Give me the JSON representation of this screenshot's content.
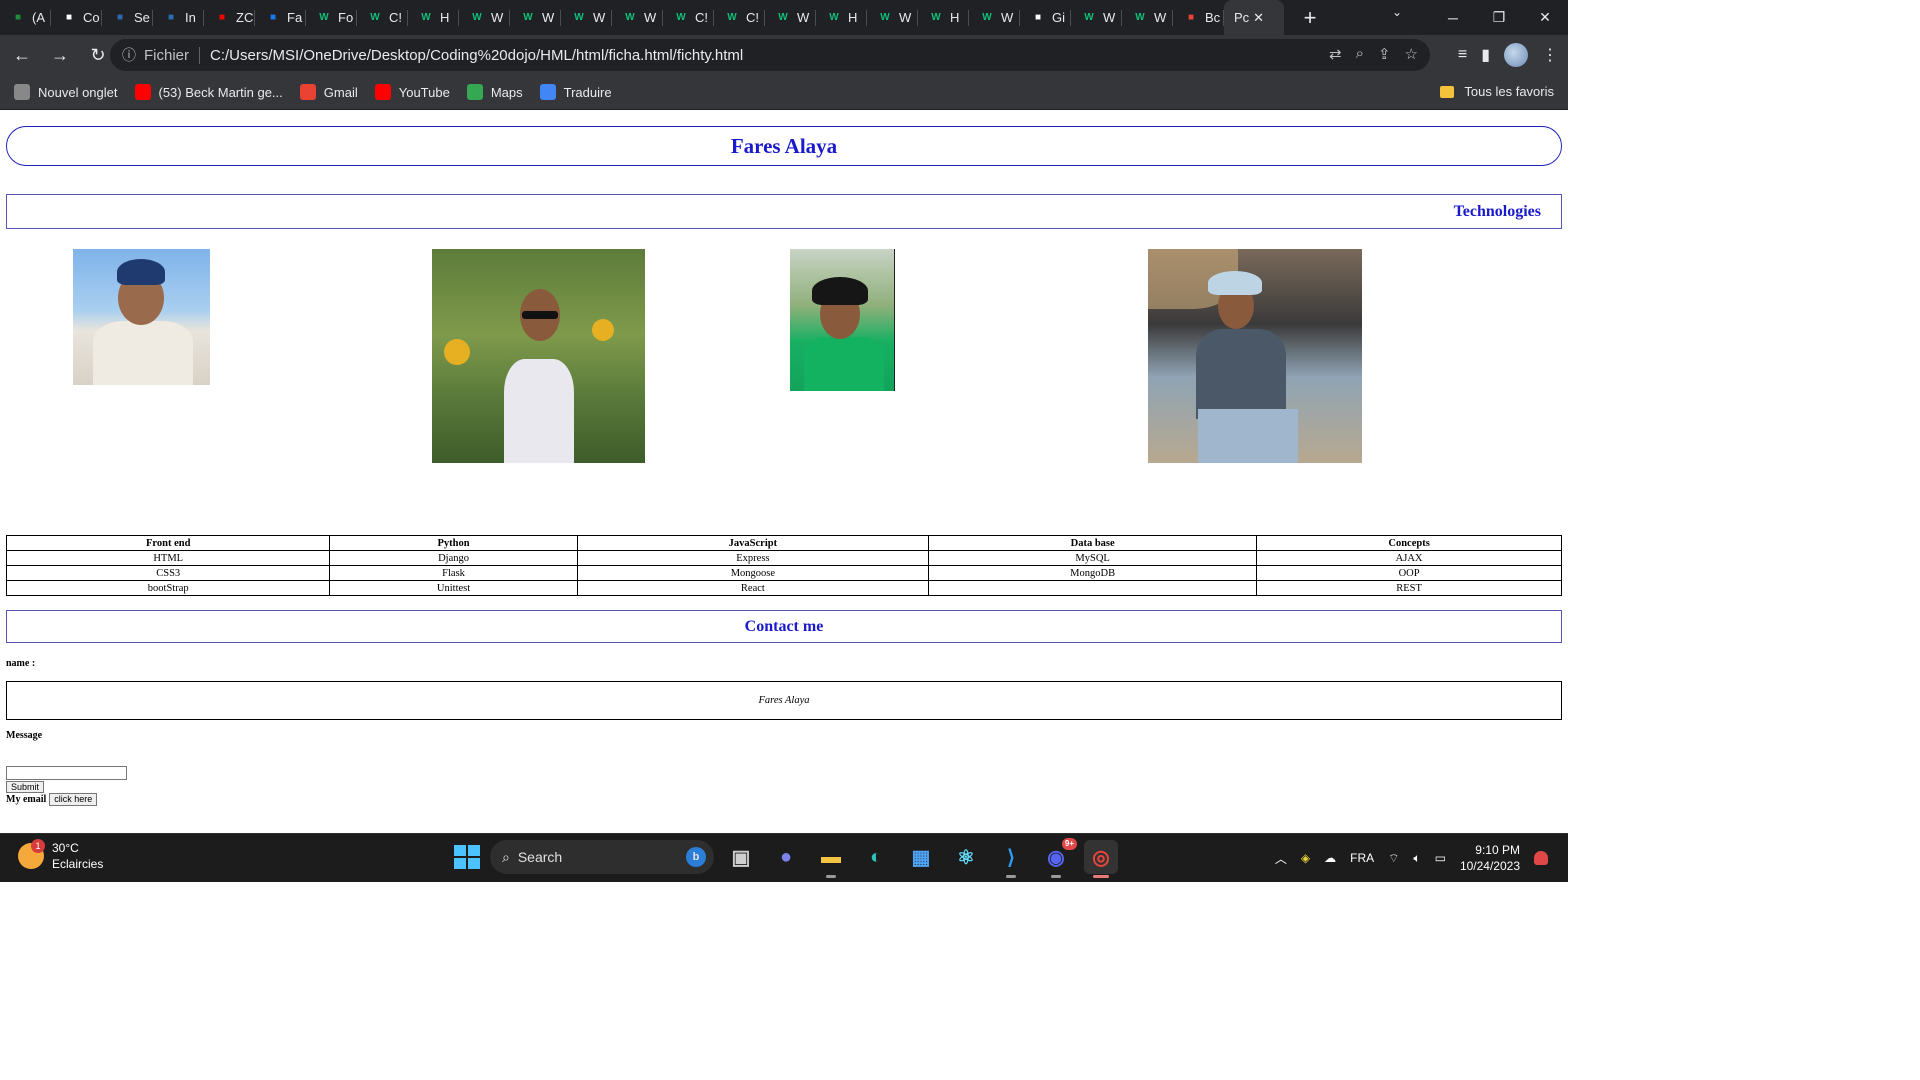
{
  "browser": {
    "tabs": [
      {
        "label": "(A",
        "icon": "sheets-icon",
        "color": "#1e8e3e"
      },
      {
        "label": "Co",
        "icon": "github-icon",
        "color": "#ffffff"
      },
      {
        "label": "Se",
        "icon": "translate-icon",
        "color": "#2b6cb0"
      },
      {
        "label": "In",
        "icon": "translate-icon",
        "color": "#2b6cb0"
      },
      {
        "label": "ZC",
        "icon": "youtube-icon",
        "color": "#ff0000"
      },
      {
        "label": "Fa",
        "icon": "facebook-icon",
        "color": "#1877f2"
      },
      {
        "label": "Fo",
        "icon": "w-icon",
        "color": "#0fbf7a"
      },
      {
        "label": "C!",
        "icon": "w-icon",
        "color": "#0fbf7a"
      },
      {
        "label": "H",
        "icon": "w-icon",
        "color": "#0fbf7a"
      },
      {
        "label": "W",
        "icon": "w-icon",
        "color": "#0fbf7a"
      },
      {
        "label": "W",
        "icon": "w-icon",
        "color": "#0fbf7a"
      },
      {
        "label": "W",
        "icon": "w-icon",
        "color": "#0fbf7a"
      },
      {
        "label": "W",
        "icon": "w-icon",
        "color": "#0fbf7a"
      },
      {
        "label": "C!",
        "icon": "w-icon",
        "color": "#0fbf7a"
      },
      {
        "label": "C!",
        "icon": "w-icon",
        "color": "#0fbf7a"
      },
      {
        "label": "W",
        "icon": "w-icon",
        "color": "#0fbf7a"
      },
      {
        "label": "H",
        "icon": "w-icon",
        "color": "#0fbf7a"
      },
      {
        "label": "W",
        "icon": "w-icon",
        "color": "#0fbf7a"
      },
      {
        "label": "H",
        "icon": "w-icon",
        "color": "#0fbf7a"
      },
      {
        "label": "W",
        "icon": "w-icon",
        "color": "#0fbf7a"
      },
      {
        "label": "Gi",
        "icon": "openai-icon",
        "color": "#ffffff"
      },
      {
        "label": "W",
        "icon": "w-icon",
        "color": "#0fbf7a"
      },
      {
        "label": "W",
        "icon": "w-icon",
        "color": "#0fbf7a"
      },
      {
        "label": "Bc",
        "icon": "gmail-icon",
        "color": "#ea4335"
      }
    ],
    "active_tab": {
      "label": "Pc",
      "close": "✕"
    },
    "new_tab": "+",
    "tab_search": "⌄",
    "window_controls": {
      "minimize": "─",
      "restore": "❐",
      "close": "✕"
    },
    "nav": {
      "back": "←",
      "forward": "→",
      "reload": "↻"
    },
    "address": {
      "info": "ⓘ",
      "scheme": "Fichier",
      "url": "C:/Users/MSI/OneDrive/Desktop/Coding%20dojo/HML/html/ficha.html/fichty.html"
    },
    "omnibox_icons": [
      "translate-icon",
      "zoom-icon",
      "share-icon",
      "star-icon"
    ],
    "bookmarks": [
      {
        "label": "Nouvel onglet",
        "icon": "chrome-icon",
        "color": "#888888"
      },
      {
        "label": "(53) Beck Martin ge...",
        "icon": "youtube-icon",
        "color": "#ff0000"
      },
      {
        "label": "Gmail",
        "icon": "gmail-icon",
        "color": "#ea4335"
      },
      {
        "label": "YouTube",
        "icon": "youtube-icon",
        "color": "#ff0000"
      },
      {
        "label": "Maps",
        "icon": "maps-icon",
        "color": "#34a853"
      },
      {
        "label": "Traduire",
        "icon": "translate-icon",
        "color": "#4285f4"
      }
    ],
    "all_bookmarks": "Tous les favoris"
  },
  "page": {
    "title": "Fares Alaya",
    "technologies_heading": "Technologies",
    "table": {
      "headers": [
        "Front end",
        "Python",
        "JavaScript",
        "Data base",
        "Concepts"
      ],
      "rows": [
        [
          "HTML",
          "Django",
          "Express",
          "MySQL",
          "AJAX"
        ],
        [
          "CSS3",
          "Flask",
          "Mongoose",
          "MongoDB",
          "OOP"
        ],
        [
          "bootStrap",
          "Unittest",
          "React",
          "",
          "REST"
        ]
      ]
    },
    "contact_heading": "Contact me",
    "name_label": "name :",
    "name_value": "Fares Alaya",
    "message_label": "Message",
    "submit_label": "Submit",
    "email_label": "My email",
    "email_button": "click here"
  },
  "taskbar": {
    "weather": {
      "temp": "30°C",
      "desc": "Eclaircies",
      "badge": "1"
    },
    "search_placeholder": "Search",
    "apps": [
      "task-view-icon",
      "teams-icon",
      "file-explorer-icon",
      "edge-icon",
      "store-icon",
      "react-devtools-icon",
      "vscode-icon",
      "discord-icon",
      "chrome-icon"
    ],
    "discord_badge": "9+",
    "tray": {
      "language": "FRA",
      "time": "9:10 PM",
      "date": "10/24/2023"
    }
  }
}
